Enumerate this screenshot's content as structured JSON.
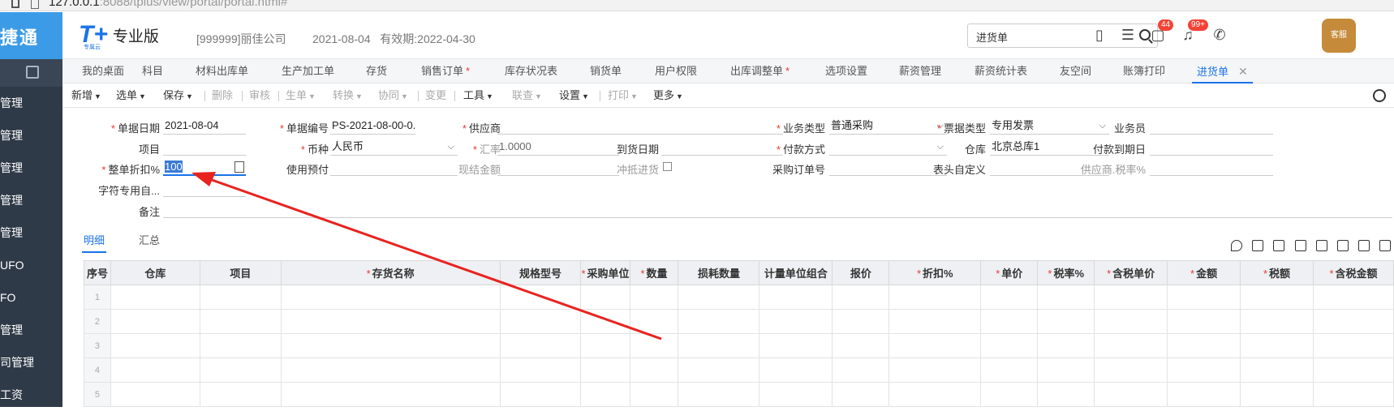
{
  "browser": {
    "url_main": "127.0.0.1",
    "url_rest": ":8088/tplus/view/portal/portal.html#"
  },
  "sidebar": {
    "brand": "捷通",
    "items": [
      "管理",
      "管理",
      "管理",
      "管理",
      "管理",
      "UFO",
      "FO",
      "管理",
      "司管理",
      "工资"
    ]
  },
  "header": {
    "logo_text": "T+",
    "logo_sub": "专属云",
    "edition": "专业版",
    "company": "[999999]丽佳公司",
    "date": "2021-08-04",
    "validity": "有效期:2022-04-30",
    "search_value": "进货单",
    "badge1": "44",
    "badge2": "99+",
    "avatar_label": "客服"
  },
  "tabs": [
    {
      "label": "我的桌面",
      "star": false
    },
    {
      "label": "科目",
      "star": false
    },
    {
      "label": "材料出库单",
      "star": false
    },
    {
      "label": "生产加工单",
      "star": false
    },
    {
      "label": "存货",
      "star": false
    },
    {
      "label": "销售订单",
      "star": true
    },
    {
      "label": "库存状况表",
      "star": false
    },
    {
      "label": "销货单",
      "star": false
    },
    {
      "label": "用户权限",
      "star": false
    },
    {
      "label": "出库调整单",
      "star": true
    },
    {
      "label": "选项设置",
      "star": false
    },
    {
      "label": "薪资管理",
      "star": false
    },
    {
      "label": "薪资统计表",
      "star": false
    },
    {
      "label": "友空间",
      "star": false
    },
    {
      "label": "账簿打印",
      "star": false
    },
    {
      "label": "进货单",
      "star": false,
      "active": true
    }
  ],
  "toolbar": [
    {
      "label": "新增",
      "caret": true,
      "disabled": false
    },
    {
      "label": "选单",
      "caret": true,
      "disabled": false
    },
    {
      "label": "保存",
      "caret": true,
      "disabled": false
    },
    {
      "label": "删除",
      "caret": false,
      "disabled": true
    },
    {
      "label": "审核",
      "caret": false,
      "disabled": true
    },
    {
      "label": "生单",
      "caret": true,
      "disabled": true
    },
    {
      "label": "转换",
      "caret": true,
      "disabled": true
    },
    {
      "label": "协同",
      "caret": true,
      "disabled": true
    },
    {
      "label": "变更",
      "caret": false,
      "disabled": true
    },
    {
      "label": "工具",
      "caret": true,
      "disabled": false
    },
    {
      "label": "联查",
      "caret": true,
      "disabled": true
    },
    {
      "label": "设置",
      "caret": true,
      "disabled": false
    },
    {
      "label": "打印",
      "caret": true,
      "disabled": true
    },
    {
      "label": "更多",
      "caret": true,
      "disabled": false
    }
  ],
  "form": {
    "doc_date_label": "单据日期",
    "doc_date": "2021-08-04",
    "doc_no_label": "单据编号",
    "doc_no": "PS-2021-08-00-0...",
    "supplier_label": "供应商",
    "supplier": "",
    "biz_type_label": "业务类型",
    "biz_type": "普通采购",
    "invoice_type_label": "票据类型",
    "invoice_type": "专用发票",
    "salesman_label": "业务员",
    "salesman": "",
    "project_label": "项目",
    "project": "",
    "currency_label": "币种",
    "currency": "人民币",
    "rate_label": "汇率",
    "rate": "1.0000",
    "arrival_label": "到货日期",
    "arrival": "",
    "payment_label": "付款方式",
    "payment": "",
    "warehouse_label": "仓库",
    "warehouse": "北京总库1",
    "due_label": "付款到期日",
    "due": "",
    "discount_label": "整单折扣%",
    "discount": "100",
    "prepay_label": "使用预付",
    "prepay": "",
    "cash_label": "现结金额",
    "cash": "",
    "offset_label": "冲抵进货",
    "po_label": "采购订单号",
    "po": "",
    "header_custom_label": "表头自定义",
    "header_custom": "",
    "supplier_tax_label": "供应商.税率%",
    "supplier_tax": "",
    "char_custom_label": "字符专用自...",
    "char_custom": "",
    "remark_label": "备注",
    "remark": ""
  },
  "subtabs": [
    "明细",
    "汇总"
  ],
  "grid": {
    "columns": [
      {
        "label": "序号",
        "req": false
      },
      {
        "label": "仓库",
        "req": false
      },
      {
        "label": "项目",
        "req": false
      },
      {
        "label": "存货名称",
        "req": true
      },
      {
        "label": "规格型号",
        "req": false
      },
      {
        "label": "采购单位",
        "req": true
      },
      {
        "label": "数量",
        "req": true
      },
      {
        "label": "损耗数量",
        "req": false
      },
      {
        "label": "计量单位组合",
        "req": false
      },
      {
        "label": "报价",
        "req": false
      },
      {
        "label": "折扣%",
        "req": true
      },
      {
        "label": "单价",
        "req": true
      },
      {
        "label": "税率%",
        "req": true
      },
      {
        "label": "含税单价",
        "req": true
      },
      {
        "label": "金额",
        "req": true
      },
      {
        "label": "税额",
        "req": true
      },
      {
        "label": "含税金额",
        "req": true
      }
    ],
    "rows": [
      "1",
      "2",
      "3",
      "4",
      "5"
    ]
  }
}
